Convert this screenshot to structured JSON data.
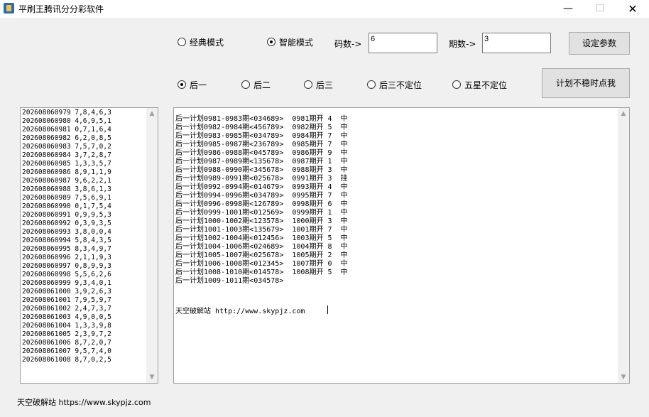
{
  "window": {
    "title": "平刷王腾讯分分彩软件",
    "minimize": "—",
    "maximize": "☐",
    "close": "✕"
  },
  "modes": {
    "classic_label": "经典模式",
    "smart_label": "智能模式",
    "selected": "smart"
  },
  "params": {
    "code_count_label": "码数->",
    "code_count_value": "6",
    "period_count_label": "期数->",
    "period_count_value": "3",
    "set_params_button": "设定参数"
  },
  "positions": {
    "options": [
      "后一",
      "后二",
      "后三",
      "后三不定位",
      "五星不定位"
    ],
    "selected": "后一"
  },
  "unstable_button": "计划不稳时点我",
  "history": [
    "202608060979 7,8,4,6,3",
    "202608060980 4,6,9,5,1",
    "202608060981 0,7,1,6,4",
    "202608060982 6,2,0,8,5",
    "202608060983 7,5,7,0,2",
    "202608060984 3,7,2,8,7",
    "202608060985 1,3,3,5,7",
    "202608060986 8,9,1,1,9",
    "202608060987 9,6,2,2,1",
    "202608060988 3,8,6,1,3",
    "202608060989 7,5,6,9,1",
    "202608060990 0,1,7,5,4",
    "202608060991 0,9,9,5,3",
    "202608060992 0,3,9,3,5",
    "202608060993 3,8,0,0,4",
    "202608060994 5,8,4,3,5",
    "202608060995 8,3,4,9,7",
    "202608060996 2,1,1,9,3",
    "202608060997 0,8,9,9,3",
    "202608060998 5,5,6,2,6",
    "202608060999 9,3,4,0,1",
    "202608061000 3,9,2,6,3",
    "202608061001 7,9,5,9,7",
    "202608061002 2,4,7,3,7",
    "202608061003 4,9,0,0,5",
    "202608061004 1,3,3,9,8",
    "202608061005 2,3,9,7,2",
    "202608061006 8,7,2,0,7",
    "202608061007 9,5,7,4,0",
    "202608061008 8,7,0,2,5"
  ],
  "plans": [
    "后一计划0981-0983期<034689>  0981期开 4  中",
    "后一计划0982-0984期<456789>  0982期开 5  中",
    "后一计划0983-0985期<034789>  0984期开 7  中",
    "后一计划0985-0987期<236789>  0985期开 7  中",
    "后一计划0986-0988期<045789>  0986期开 9  中",
    "后一计划0987-0989期<135678>  0987期开 1  中",
    "后一计划0988-0990期<345678>  0988期开 3  中",
    "后一计划0989-0991期<025678>  0991期开 3  挂",
    "后一计划0992-0994期<014679>  0993期开 4  中",
    "后一计划0994-0996期<034789>  0995期开 7  中",
    "后一计划0996-0998期<126789>  0998期开 6  中",
    "后一计划0999-1001期<012569>  0999期开 1  中",
    "后一计划1000-1002期<123578>  1000期开 3  中",
    "后一计划1001-1003期<135679>  1001期开 7  中",
    "后一计划1002-1004期<012456>  1003期开 5  中",
    "后一计划1004-1006期<024689>  1004期开 8  中",
    "后一计划1005-1007期<025678>  1005期开 2  中",
    "后一计划1006-1008期<012345>  1007期开 0  中",
    "后一计划1008-1010期<014578>  1008期开 5  中",
    "后一计划1009-1011期<034578>"
  ],
  "plan_footer": "天空破解站 http://www.skypjz.com",
  "bottom_footer": "天空破解站 https://www.skypjz.com",
  "scroll": {
    "up": "▲",
    "down": "▼"
  }
}
